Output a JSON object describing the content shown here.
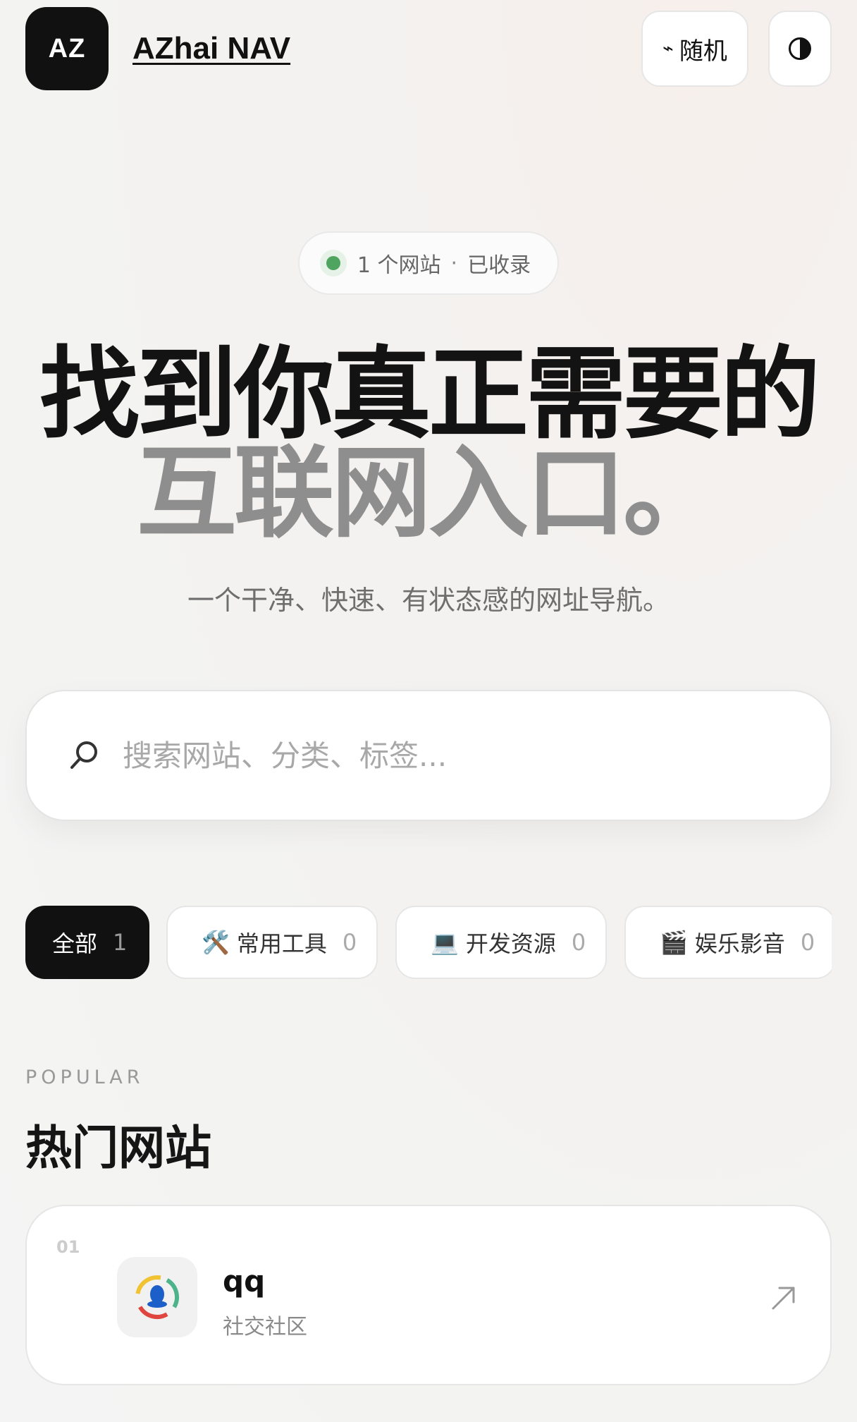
{
  "header": {
    "logo_text": "AZ",
    "site_name": "AZhai NAV",
    "random_icon": "⌁",
    "random_label": "随机",
    "theme_toggle_icon": "contrast-icon"
  },
  "stats": {
    "count_text": "1 个网站",
    "separator": "·",
    "suffix": "已收录"
  },
  "hero": {
    "title_line1": "找到你真正需要的",
    "title_line2": "互联网入口。",
    "subtitle": "一个干净、快速、有状态感的网址导航。"
  },
  "search": {
    "placeholder": "搜索网站、分类、标签...",
    "value": ""
  },
  "categories": [
    {
      "emoji": "",
      "label": "全部",
      "count": "1",
      "active": true
    },
    {
      "emoji": "🛠️",
      "label": "常用工具",
      "count": "0",
      "active": false
    },
    {
      "emoji": "💻",
      "label": "开发资源",
      "count": "0",
      "active": false
    },
    {
      "emoji": "🎬",
      "label": "娱乐影音",
      "count": "0",
      "active": false
    }
  ],
  "popular": {
    "kicker": "POPULAR",
    "title": "热门网站",
    "items": [
      {
        "rank": "01",
        "name": "qq",
        "category": "社交社区",
        "icon": "qq-icon"
      }
    ]
  },
  "colors": {
    "primary": "#111111",
    "muted_title": "#8e8e8e",
    "status_green": "#4fa45f"
  }
}
